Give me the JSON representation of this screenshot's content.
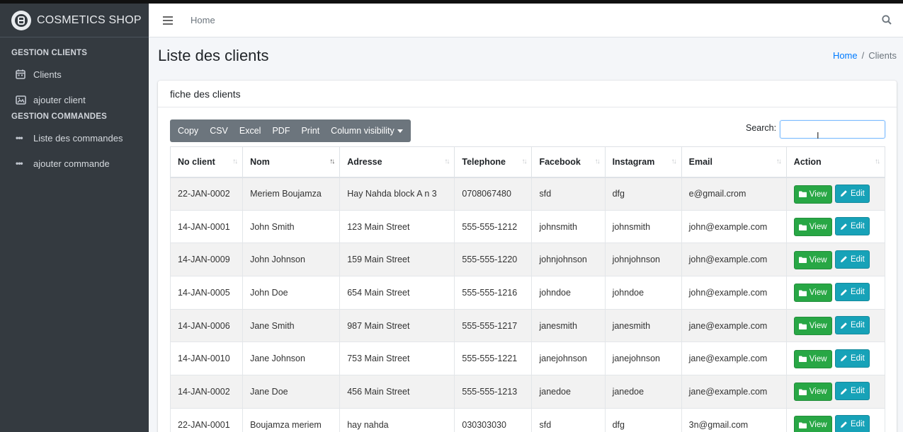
{
  "brand": {
    "name": "COSMETICS SHOP"
  },
  "sidebar": {
    "sections": [
      {
        "header": "GESTION CLIENTS",
        "items": [
          {
            "label": "Clients",
            "icon": "calendar-icon"
          },
          {
            "label": "ajouter client",
            "icon": "image-icon"
          }
        ]
      },
      {
        "header": "GESTION COMMANDES",
        "items": [
          {
            "label": "Liste des commandes",
            "icon": "dots-icon"
          },
          {
            "label": "ajouter commande",
            "icon": "dots-icon"
          }
        ]
      }
    ]
  },
  "topnav": {
    "home": "Home"
  },
  "page": {
    "title": "Liste des clients"
  },
  "breadcrumb": {
    "home": "Home",
    "sep": "/",
    "current": "Clients"
  },
  "card": {
    "title": "fiche des clients"
  },
  "toolbar": {
    "copy": "Copy",
    "csv": "CSV",
    "excel": "Excel",
    "pdf": "PDF",
    "print": "Print",
    "colvis": "Column visibility"
  },
  "search": {
    "label": "Search:",
    "value": ""
  },
  "table": {
    "columns": [
      "No client",
      "Nom",
      "Adresse",
      "Telephone",
      "Facebook",
      "Instagram",
      "Email",
      "Action"
    ],
    "sorted_column": "Nom",
    "view_label": "View",
    "edit_label": "Edit",
    "rows": [
      [
        "22-JAN-0002",
        "Meriem Boujamza",
        "Hay Nahda block A n 3",
        "0708067480",
        "sfd",
        "dfg",
        "e@gmail.crom"
      ],
      [
        "14-JAN-0001",
        "John Smith",
        "123 Main Street",
        "555-555-1212",
        "johnsmith",
        "johnsmith",
        "john@example.com"
      ],
      [
        "14-JAN-0009",
        "John Johnson",
        "159 Main Street",
        "555-555-1220",
        "johnjohnson",
        "johnjohnson",
        "john@example.com"
      ],
      [
        "14-JAN-0005",
        "John Doe",
        "654 Main Street",
        "555-555-1216",
        "johndoe",
        "johndoe",
        "john@example.com"
      ],
      [
        "14-JAN-0006",
        "Jane Smith",
        "987 Main Street",
        "555-555-1217",
        "janesmith",
        "janesmith",
        "jane@example.com"
      ],
      [
        "14-JAN-0010",
        "Jane Johnson",
        "753 Main Street",
        "555-555-1221",
        "janejohnson",
        "janejohnson",
        "jane@example.com"
      ],
      [
        "14-JAN-0002",
        "Jane Doe",
        "456 Main Street",
        "555-555-1213",
        "janedoe",
        "janedoe",
        "jane@example.com"
      ],
      [
        "22-JAN-0001",
        "Boujamza meriem",
        "hay nahda",
        "030303030",
        "sfd",
        "dfg",
        "3n@gmail.com"
      ]
    ]
  },
  "colors": {
    "sidebar": "#343a40",
    "view": "#28a745",
    "edit": "#17a2b8",
    "link": "#007bff",
    "toolbar": "#6c757d"
  }
}
